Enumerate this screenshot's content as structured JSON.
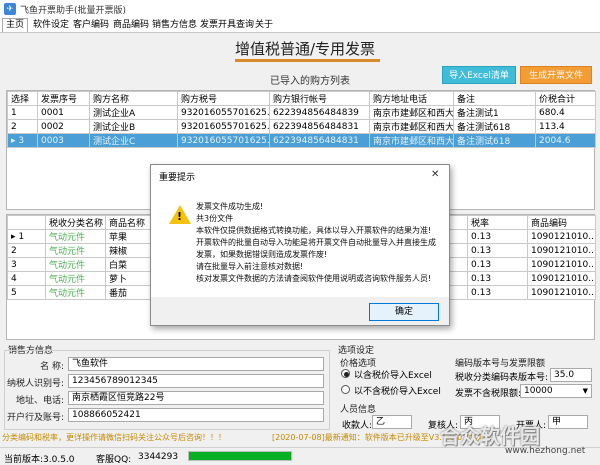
{
  "window": {
    "title": "飞鱼开票助手(批量开票版)"
  },
  "menu": [
    "主页",
    "软件设定",
    "客户编码",
    "商品编码",
    "销售方信息",
    "发票开具查询",
    "关于"
  ],
  "heading": "增值税普通/专用发票",
  "list_caption": "已导入的购方列表",
  "buttons": {
    "import_excel": "导入Excel清单",
    "generate": "生成开票文件"
  },
  "buyer_table": {
    "headers": [
      "选择",
      "发票序号",
      "购方名称",
      "购方税号",
      "购方银行帐号",
      "购方地址电话",
      "备注",
      "价税合计"
    ],
    "rows": [
      [
        "1",
        "0001",
        "测试企业A",
        "932016055701625...",
        "622394856484839",
        "南京市建邺区和西大...",
        "备注测试1",
        "680.4"
      ],
      [
        "2",
        "0002",
        "测试企业B",
        "932016055701625...",
        "622394856484831",
        "南京市建邺区和西大...",
        "备注测试618",
        "113.4"
      ],
      [
        "3",
        "0003",
        "测试企业C",
        "932016055701625...",
        "622394856484831",
        "南京市建邺区和西大...",
        "备注测试618",
        "2004.6"
      ]
    ],
    "selected_marker": "▸"
  },
  "goods_table": {
    "headers": [
      "",
      "税收分类名称",
      "商品名称",
      "",
      "税率",
      "商品编码"
    ],
    "rows": [
      [
        "1",
        "气动元件",
        "苹果",
        "0.13",
        "1090121010..."
      ],
      [
        "2",
        "气动元件",
        "辣椒",
        "0.13",
        "1090121010..."
      ],
      [
        "3",
        "气动元件",
        "白菜",
        "0.13",
        "1090121010..."
      ],
      [
        "4",
        "气动元件",
        "萝卜",
        "0.13",
        "1090121010..."
      ],
      [
        "5",
        "气动元件",
        "番茄",
        "0.13",
        "1090121010..."
      ]
    ],
    "row_marker": "▸"
  },
  "dialog": {
    "title": "重要提示",
    "close": "✕",
    "lines": [
      "发票文件成功生成!",
      "共3份文件",
      "本软件仅提供数据格式转换功能，具体以导入开票软件的结果为准!",
      "开票软件的批量自动导入功能是将开票文件自动批量导入并直接生成",
      "发票，如果数据错误则造成发票作废!",
      "请在批量导入前注意核对数据!",
      "核对发票文件数据的方法请查阅软件使用说明或咨询软件服务人员!"
    ],
    "ok": "确定"
  },
  "seller": {
    "section": "销售方信息",
    "name_label": "名  称:",
    "name_value": "飞鱼软件",
    "tax_label": "纳税人识别号:",
    "tax_value": "123456789012345",
    "addr_label": "地址、电话:",
    "addr_value": "南京栖霞区恒竞路22号",
    "bank_label": "开户行及账号:",
    "bank_value": "108866052421"
  },
  "options": {
    "section": "选项设定",
    "price_title": "价格选项",
    "opt_with_tax": "以含税价导入Excel",
    "opt_without_tax": "以不含税价导入Excel",
    "version_title": "编码版本号与发票限额",
    "code_version_label": "税收分类编码表版本号:",
    "code_version_value": "35.0",
    "limit_label": "发票不含税限额:",
    "limit_value": "10000",
    "people_title": "人员信息",
    "payee_label": "收款人:",
    "payee_value": "乙",
    "reviewer_label": "复核人:",
    "reviewer_value": "丙",
    "drawer_label": "开票人:",
    "drawer_value": "甲"
  },
  "marquee": {
    "left": "分类编码和税率，更详操作请微信扫码关注公众号后咨询！！！",
    "right": "[2020-07-08]最新通知：软件版本已升级至V3.1.0.0, 本次主"
  },
  "status": {
    "version": "当前版本:3.0.5.0",
    "service": "客服QQ:",
    "qq_tail": "3344293",
    "progress": 1.0
  },
  "watermark": {
    "text": "合众软件园",
    "url": "www.hezhong.net"
  },
  "colors": {
    "accent_blue": "#3fbcd8",
    "accent_orange": "#f39c34",
    "selected_row": "#4a9fd6",
    "green_text": "#4caf50",
    "warning": "#f4c20d"
  }
}
